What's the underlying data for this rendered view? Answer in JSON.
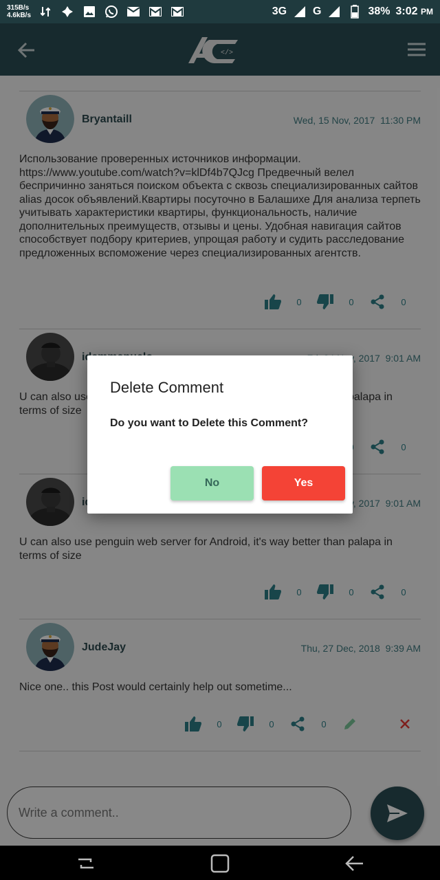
{
  "status_bar": {
    "speed_up": "315B/s",
    "speed_down": "4.6kB/s",
    "network_1": "3G",
    "network_2": "G",
    "battery": "38%",
    "time": "3:02",
    "ampm": "PM"
  },
  "comments": [
    {
      "author": "Bryantaill",
      "date": "Wed, 15 Nov, 2017",
      "time": "11:30 PM",
      "text": "Использование проверенных источников информации. https://www.youtube.com/watch?v=klDf4b7QJcg Предвечный велел беспричинно заняться поиском объекта с сквозь специализированных сайтов alias досок объявлений.Квартиры посуточно в Балашихе Для анализа терпеть учитывать характеристики квартиры, функциональность, наличие дополнительных преимуществ, отзывы и цены. Удобная навигация сайтов способствует подбору критериев, упрощая работу и судить расследование предложенных вспоможение через специализированных агентств.",
      "likes": "0",
      "dislikes": "0",
      "shares": "0",
      "avatar": "captain"
    },
    {
      "author": "idemmanuelo",
      "date": "Fri, 24 Nov, 2017",
      "time": "9:01 AM",
      "text": "U can also use penguin web server for Android, it's way better than palapa in terms of size",
      "likes": "0",
      "dislikes": "0",
      "shares": "0",
      "avatar": "photo"
    },
    {
      "author": "idemmanuelo",
      "date": "Fri, 24 Nov, 2017",
      "time": "9:01 AM",
      "text": "U can also use penguin web server for Android, it's way better than palapa in terms of size",
      "likes": "0",
      "dislikes": "0",
      "shares": "0",
      "avatar": "photo"
    },
    {
      "author": "JudeJay",
      "date": "Thu, 27 Dec, 2018",
      "time": "9:39 AM",
      "text": "Nice one.. this Post would certainly help out sometime...",
      "likes": "0",
      "dislikes": "0",
      "shares": "0",
      "avatar": "captain"
    }
  ],
  "dialog": {
    "title": "Delete Comment",
    "message": "Do you want to Delete this Comment?",
    "no_label": "No",
    "yes_label": "Yes"
  },
  "comment_input": {
    "placeholder": "Write a comment.."
  },
  "colors": {
    "primary": "#2b4e54",
    "accent_text": "#2d7f88",
    "no_button": "#9be0b3",
    "yes_button": "#f44336"
  }
}
